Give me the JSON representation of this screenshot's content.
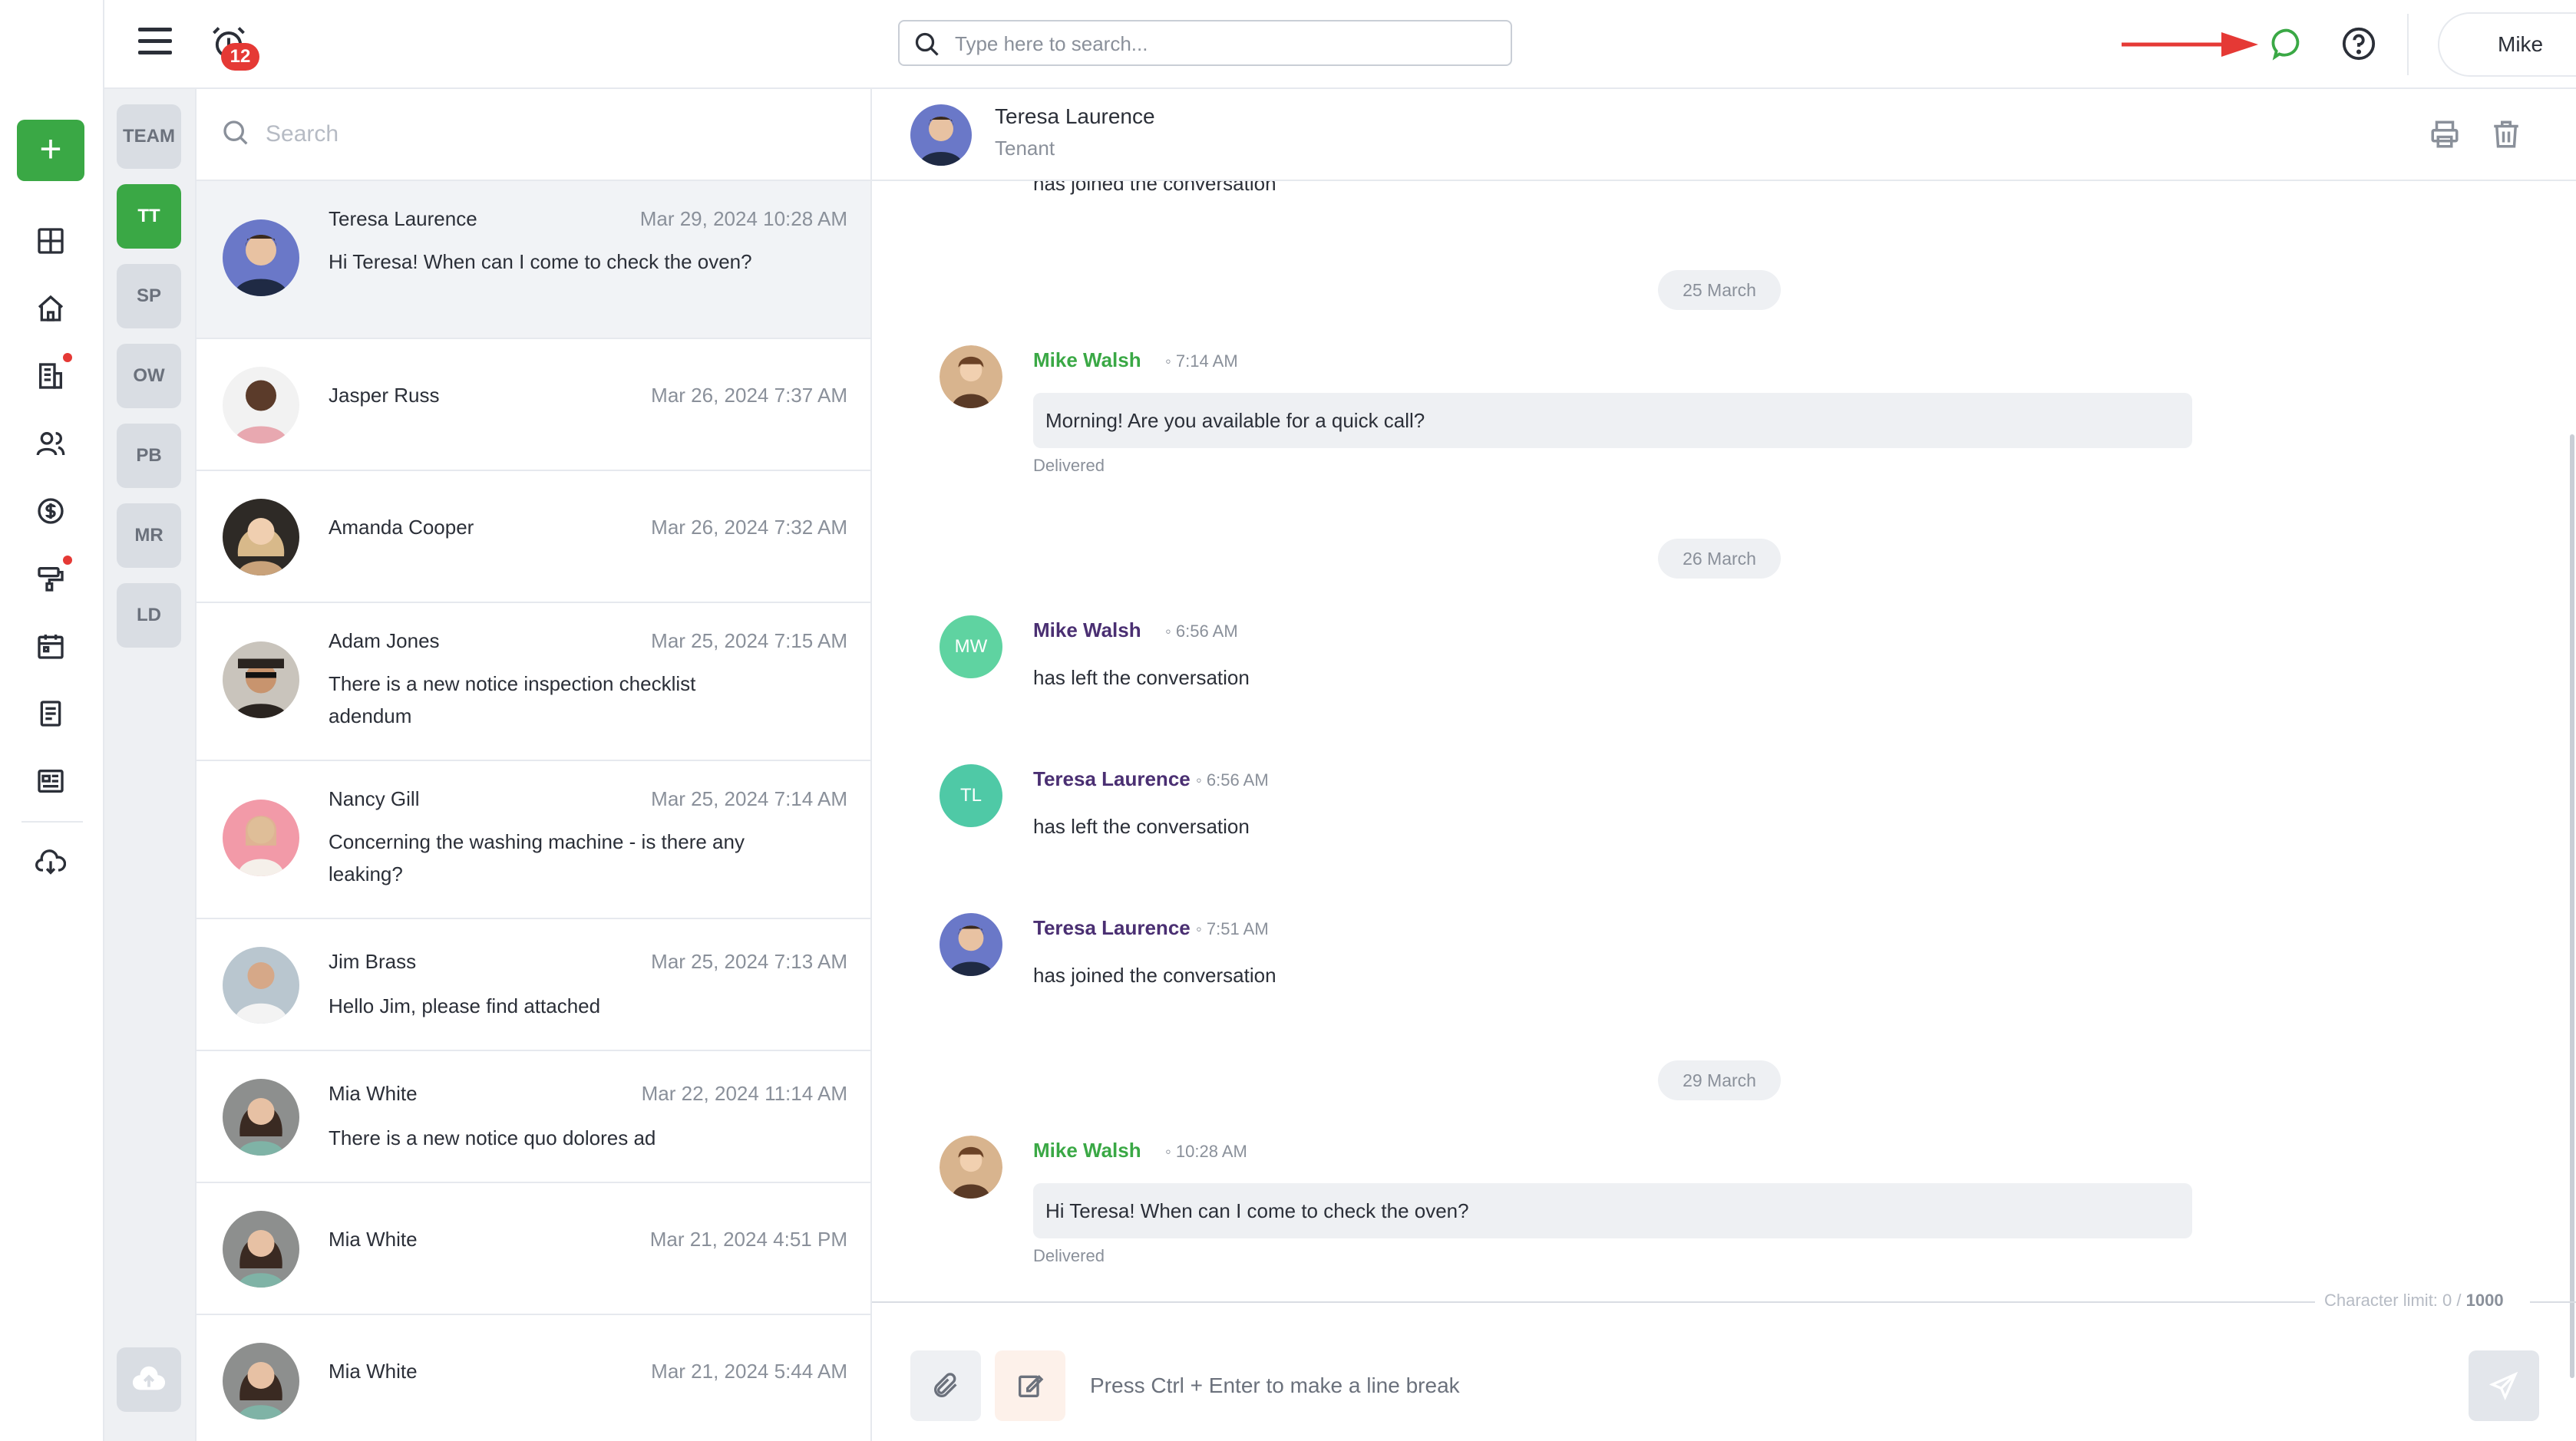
{
  "topbar": {
    "notification_count": "12",
    "search_placeholder": "Type here to search...",
    "user_name": "Mike"
  },
  "team": {
    "items": [
      "TEAM",
      "TT",
      "SP",
      "OW",
      "PB",
      "MR",
      "LD"
    ],
    "active": "TT"
  },
  "conversations": {
    "search_placeholder": "Search",
    "items": [
      {
        "name": "Teresa Laurence",
        "date": "Mar 29, 2024 10:28 AM",
        "message": "Hi Teresa! When can I come to check the oven?"
      },
      {
        "name": "Jasper Russ",
        "date": "Mar 26, 2024 7:37 AM",
        "message": ""
      },
      {
        "name": "Amanda Cooper",
        "date": "Mar 26, 2024 7:32 AM",
        "message": ""
      },
      {
        "name": "Adam Jones",
        "date": "Mar 25, 2024 7:15 AM",
        "message": "There is a new notice inspection checklist adendum"
      },
      {
        "name": "Nancy Gill",
        "date": "Mar 25, 2024 7:14 AM",
        "message": "Concerning the washing machine - is there any leaking?"
      },
      {
        "name": "Jim Brass",
        "date": "Mar 25, 2024 7:13 AM",
        "message": "Hello Jim, please find attached"
      },
      {
        "name": "Mia White",
        "date": "Mar 22, 2024 11:14 AM",
        "message": "There is a new notice quo dolores ad"
      },
      {
        "name": "Mia White",
        "date": "Mar 21, 2024 4:51 PM",
        "message": ""
      },
      {
        "name": "Mia White",
        "date": "Mar 21, 2024 5:44 AM",
        "message": ""
      }
    ]
  },
  "chat": {
    "header_name": "Teresa Laurence",
    "header_role": "Tenant",
    "top_partial_text": "has joined the conversation",
    "date_separators": [
      "25 March",
      "26 March",
      "29 March"
    ],
    "messages": [
      {
        "sender": "Mike Walsh",
        "time": "7:14 AM",
        "text": "Morning! Are you available for a quick call?",
        "status": "Delivered"
      },
      {
        "sender": "Mike Walsh",
        "initials": "MW",
        "time": "6:56 AM",
        "text": "has left the conversation"
      },
      {
        "sender": "Teresa Laurence",
        "initials": "TL",
        "time": "6:56 AM",
        "text": "has left the conversation"
      },
      {
        "sender": "Teresa Laurence",
        "time": "7:51 AM",
        "text": "has joined the conversation"
      },
      {
        "sender": "Mike Walsh",
        "time": "10:28 AM",
        "text": "Hi Teresa! When can I come to check the oven?",
        "status": "Delivered"
      }
    ],
    "char_limit_label": "Character limit: 0 / ",
    "char_limit_max": "1000",
    "composer_placeholder": "Press Ctrl + Enter to make a line break"
  },
  "colors": {
    "accent_green": "#3aa845",
    "alert_red": "#e53935",
    "sender_purple": "#4a2f72",
    "initials_mw": "#5fd3a1",
    "initials_tl": "#4fc9a6"
  }
}
